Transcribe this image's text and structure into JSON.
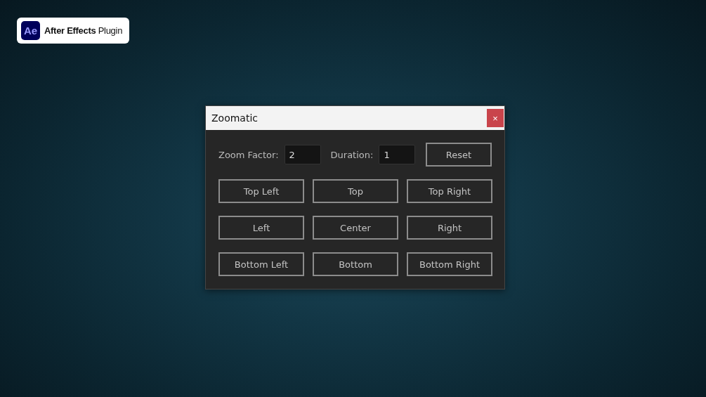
{
  "badge": {
    "logo": "Ae",
    "label": "**After Effects** Plugin"
  },
  "window": {
    "title": "Zoomatic",
    "close": "×"
  },
  "fields": [
    {
      "label": "Zoom Factor:",
      "value": "2"
    },
    {
      "label": "Duration:",
      "value": "1"
    }
  ],
  "reset_button": "Reset",
  "position_buttons": [
    "Top Left",
    "Top",
    "Top Right",
    "Left",
    "Center",
    "Right",
    "Bottom Left",
    "Bottom",
    "Bottom Right"
  ]
}
